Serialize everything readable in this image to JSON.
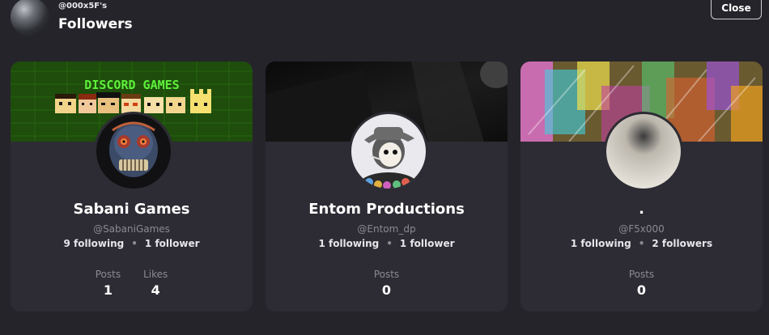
{
  "header": {
    "owner_handle": "@000x5F's",
    "title": "Followers",
    "close_label": "Close"
  },
  "cards": [
    {
      "name": "Sabani Games",
      "handle": "@SabaniGames",
      "following": "9 following",
      "followers": "1 follower",
      "banner_text": "DISCORD GAMES",
      "stats": [
        {
          "label": "Posts",
          "value": "1"
        },
        {
          "label": "Likes",
          "value": "4"
        }
      ]
    },
    {
      "name": "Entom Productions",
      "handle": "@Entom_dp",
      "following": "1 following",
      "followers": "1 follower",
      "stats": [
        {
          "label": "Posts",
          "value": "0"
        }
      ]
    },
    {
      "name": ".",
      "handle": "@F5x000",
      "following": "1 following",
      "followers": "2 followers",
      "stats": [
        {
          "label": "Posts",
          "value": "0"
        }
      ]
    }
  ],
  "separator": "•",
  "colors": {
    "background": "#25242b",
    "card": "#2d2c34",
    "muted_text": "#8b8a93",
    "banner1_green": "#1e4d0c"
  }
}
